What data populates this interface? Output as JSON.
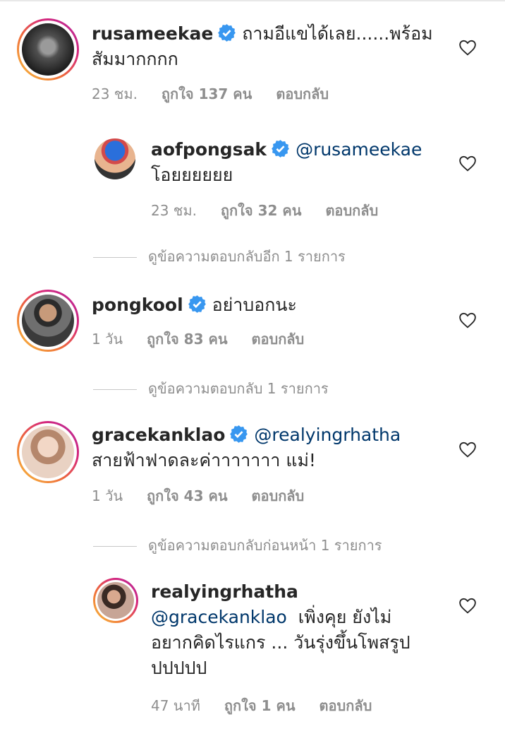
{
  "comments": [
    {
      "username": "rusameekae",
      "verified": true,
      "mention": "",
      "text_line1": "ถามอีแขได้เลย......พร้อม",
      "text_line2": "สัมมากกกก",
      "time": "23 ชม.",
      "likes": "ถูกใจ 137 คน",
      "reply": "ตอบกลับ"
    },
    {
      "username": "aofpongsak",
      "verified": true,
      "mention": "@rusameekae",
      "text_line1": "โอยยยยยย",
      "time": "23 ชม.",
      "likes": "ถูกใจ 32 คน",
      "reply": "ตอบกลับ",
      "more_replies": "ดูข้อความตอบกลับอีก 1 รายการ"
    },
    {
      "username": "pongkool",
      "verified": true,
      "text": "อย่าบอกนะ",
      "time": "1 วัน",
      "likes": "ถูกใจ 83 คน",
      "reply": "ตอบกลับ",
      "more_replies": "ดูข้อความตอบกลับ 1 รายการ"
    },
    {
      "username": "gracekanklao",
      "verified": true,
      "mention": "@realyingrhatha",
      "text_line1": "สายฟ้าฟาดละค่าาาาาาา แม่!",
      "time": "1 วัน",
      "likes": "ถูกใจ 43 คน",
      "reply": "ตอบกลับ",
      "more_replies": "ดูข้อความตอบกลับก่อนหน้า 1 รายการ"
    },
    {
      "username": "realyingrhatha",
      "verified": false,
      "mention": "@gracekanklao",
      "text_line1": "เพิ่งคุย ยังไม่",
      "text_line2": "อยากคิดไรแกร ... วันรุ่งขึ้นโพสรูป",
      "text_line3": "ปปปปป",
      "time": "47 นาที",
      "likes": "ถูกใจ 1 คน",
      "reply": "ตอบกลับ"
    }
  ],
  "icons": {
    "like": "heart-outline-icon",
    "verified": "verified-badge-icon"
  },
  "colors": {
    "verified": "#3897f0",
    "mention": "#00376b",
    "meta": "#8e8e8e"
  }
}
